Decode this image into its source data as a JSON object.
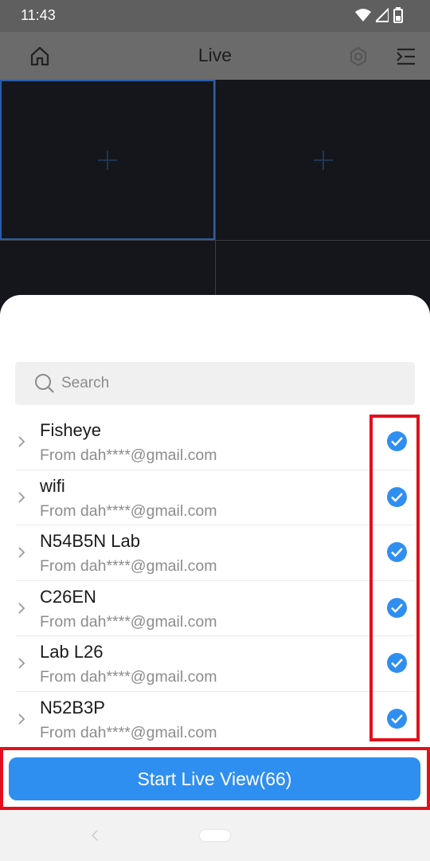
{
  "status_bar": {
    "time": "11:43",
    "icons": [
      "wifi-icon",
      "signal-icon",
      "battery-icon"
    ]
  },
  "header": {
    "title": "Live",
    "icons": [
      "home-icon",
      "settings-icon",
      "menu-icon"
    ]
  },
  "video_grid": {
    "cells": [
      {
        "icon": "add-icon",
        "selected": true
      },
      {
        "icon": "add-icon",
        "selected": false
      },
      {
        "icon": "",
        "selected": false
      },
      {
        "icon": "",
        "selected": false
      }
    ]
  },
  "sheet": {
    "search": {
      "placeholder": "Search",
      "value": ""
    },
    "devices": [
      {
        "name": "Fisheye",
        "source": "From dah****@gmail.com",
        "checked": true
      },
      {
        "name": "wifi",
        "source": "From dah****@gmail.com",
        "checked": true
      },
      {
        "name": "N54B5N Lab",
        "source": "From dah****@gmail.com",
        "checked": true
      },
      {
        "name": "C26EN",
        "source": "From dah****@gmail.com",
        "checked": true
      },
      {
        "name": "Lab L26",
        "source": "From dah****@gmail.com",
        "checked": true
      },
      {
        "name": "N52B3P",
        "source": "From dah****@gmail.com",
        "checked": true
      }
    ],
    "start_button_label": "Start Live View(66)"
  },
  "colors": {
    "accent": "#2f8ff0",
    "highlight": "#e3101c",
    "grid_cell": "#14161c"
  }
}
